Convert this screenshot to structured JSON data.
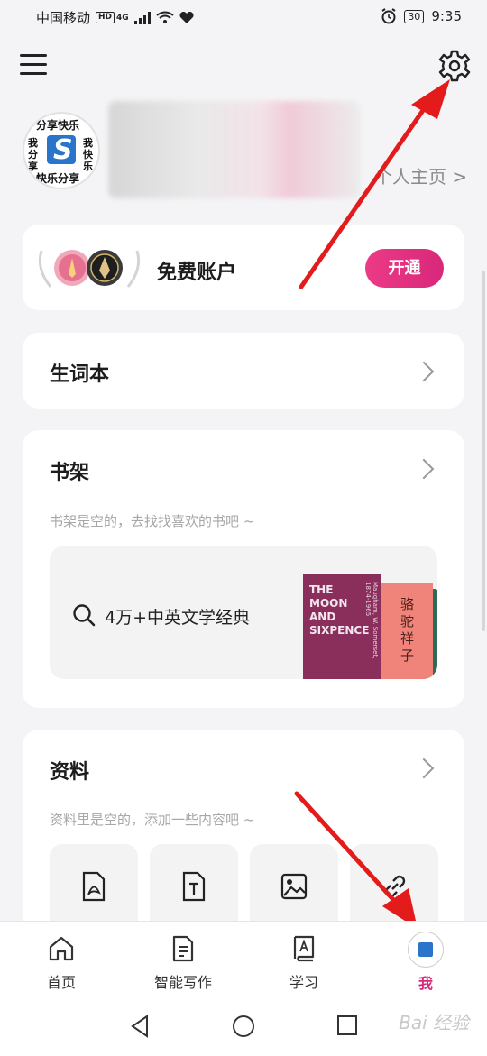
{
  "status_bar": {
    "carrier": "中国移动",
    "hd": "HD",
    "signal": "4G",
    "battery": "30",
    "time": "9:35"
  },
  "header": {
    "menu_icon": "menu-icon",
    "settings_icon": "gear-icon"
  },
  "profile": {
    "avatar_text_top": "分享快乐",
    "avatar_text_left": "我分享",
    "avatar_text_right": "我快乐",
    "avatar_text_bottom": "快乐分享",
    "avatar_letter": "S",
    "homepage_link": "个人主页 >"
  },
  "account": {
    "title": "免费账户",
    "open_button": "开通"
  },
  "vocab": {
    "title": "生词本"
  },
  "shelf": {
    "title": "书架",
    "empty_hint": "书架是空的，去找找喜欢的书吧 ~",
    "search_text": "4万+中英文学经典",
    "book1_title": "THE MOON AND SIXPENCE",
    "book1_spine": "Maugham, W. Somerset, 1874-1965",
    "book2_title": "骆驼祥子"
  },
  "data": {
    "title": "资料",
    "empty_hint": "资料里是空的，添加一些内容吧 ~"
  },
  "nav": {
    "items": [
      {
        "label": "首页",
        "icon": "home-icon"
      },
      {
        "label": "智能写作",
        "icon": "document-icon"
      },
      {
        "label": "学习",
        "icon": "book-icon"
      },
      {
        "label": "我",
        "icon": "avatar"
      }
    ],
    "active_color": "#d8287a"
  },
  "watermark": "Bai 经验"
}
